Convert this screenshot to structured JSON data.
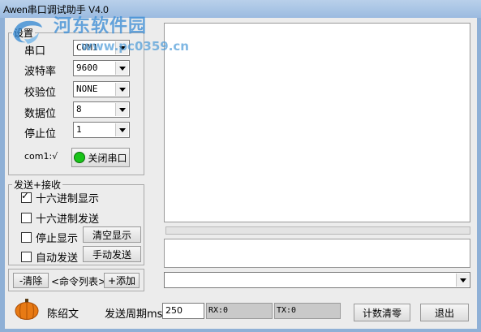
{
  "window": {
    "title": "Awen串口调试助手 V4.0",
    "watermark": "河东软件园",
    "watermark_url": "www.pc0359.cn"
  },
  "settings": {
    "legend": "设置",
    "port_label": "串口",
    "port_value": "COM1",
    "baud_label": "波特率",
    "baud_value": "9600",
    "parity_label": "校验位",
    "parity_value": "NONE",
    "databits_label": "数据位",
    "databits_value": "8",
    "stopbits_label": "停止位",
    "stopbits_value": "1",
    "port_status": "com1:√",
    "close_port_button": "关闭串口",
    "indicator_color": "#19c419"
  },
  "send_receive": {
    "legend": "发送+接收",
    "hex_display": "十六进制显示",
    "hex_display_checked": true,
    "hex_send": "十六进制发送",
    "hex_send_checked": false,
    "stop_display": "停止显示",
    "stop_display_checked": false,
    "clear_display_button": "清空显示",
    "auto_send": "自动发送",
    "auto_send_checked": false,
    "manual_send_button": "手动发送"
  },
  "commands": {
    "remove_button": "-清除",
    "list_label": "<命令列表>",
    "add_button": "+添加"
  },
  "footer": {
    "author": "陈绍文",
    "period_label": "发送周期ms",
    "period_value": "250",
    "rx": "RX:0",
    "tx": "TX:0",
    "reset_count_button": "计数清零",
    "exit_button": "退出"
  }
}
